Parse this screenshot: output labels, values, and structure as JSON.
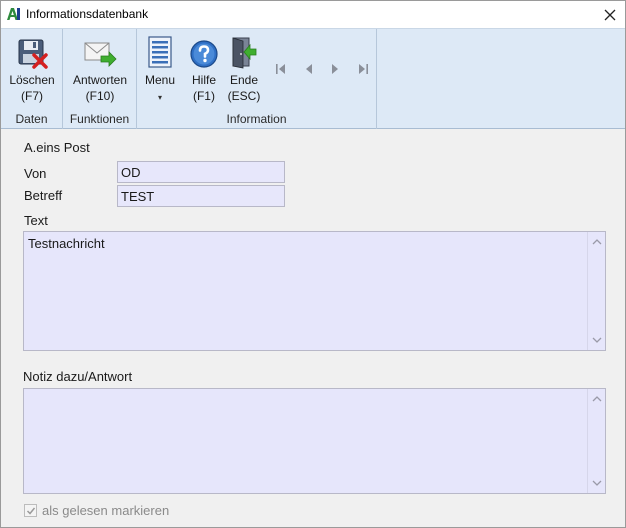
{
  "window": {
    "title": "Informationsdatenbank",
    "logo_text": "A"
  },
  "ribbon": {
    "groups": {
      "daten": "Daten",
      "funktionen": "Funktionen",
      "information": "Information"
    },
    "buttons": {
      "loeschen": {
        "label": "Löschen",
        "shortcut": "(F7)"
      },
      "antworten": {
        "label": "Antworten",
        "shortcut": "(F10)"
      },
      "menu": {
        "label": "Menu",
        "caret": "▾"
      },
      "hilfe": {
        "label": "Hilfe",
        "shortcut": "(F1)"
      },
      "ende": {
        "label": "Ende",
        "shortcut": "(ESC)"
      }
    },
    "nav_icons": [
      "first-record-icon",
      "previous-record-icon",
      "next-record-icon",
      "last-record-icon"
    ]
  },
  "form": {
    "section_title": "A.eins Post",
    "von_label": "Von",
    "von_value": "OD",
    "betreff_label": "Betreff",
    "betreff_value": "TEST",
    "text_label": "Text",
    "text_value": "Testnachricht",
    "notiz_label": "Notiz dazu/Antwort",
    "notiz_value": "",
    "checkbox_label": "als gelesen markieren",
    "checkbox_checked": true
  },
  "colors": {
    "ribbon_bg": "#dde9f6",
    "field_bg": "#e7e7fb",
    "logo_green": "#2e8b3e",
    "logo_blue": "#1b3f8f"
  }
}
